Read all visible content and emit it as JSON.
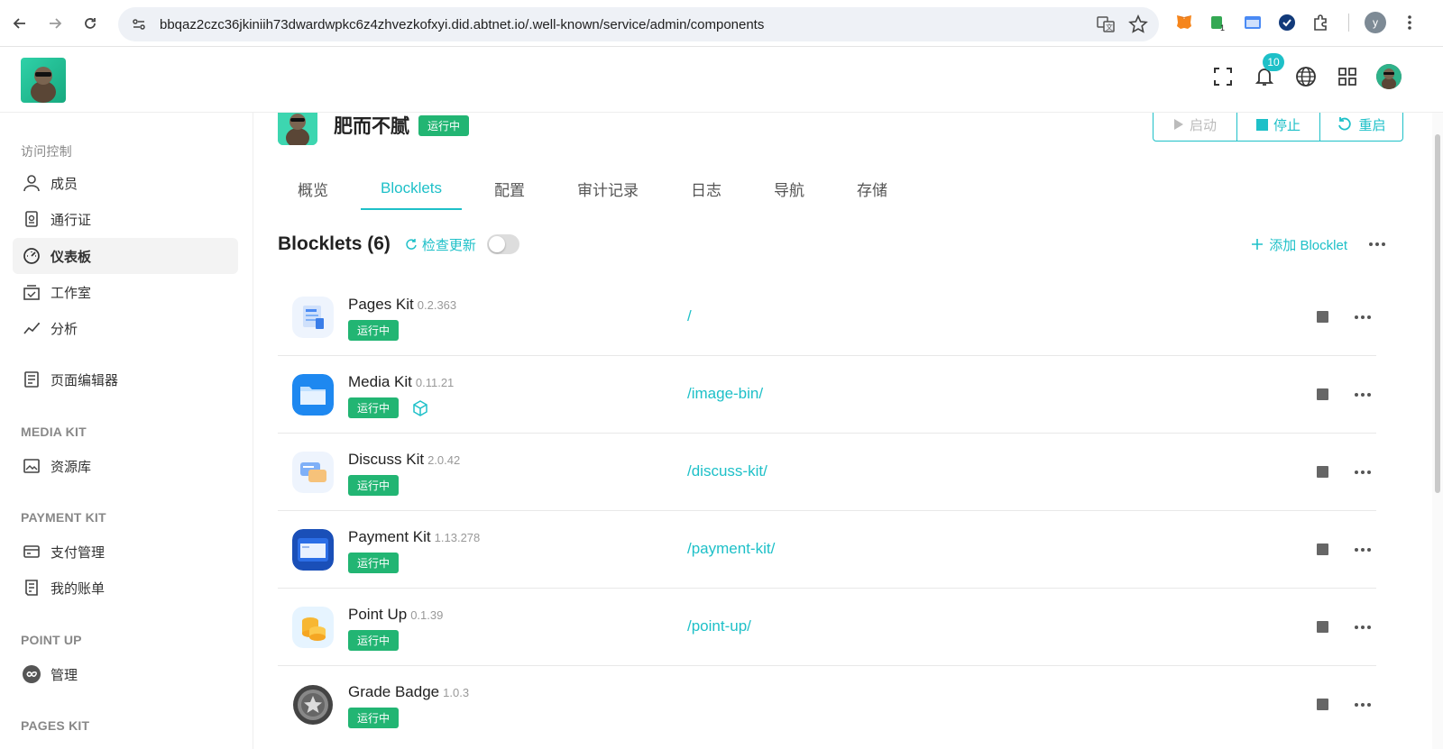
{
  "browser": {
    "url": "bbqaz2czc36jkiniih73dwardwpkc6z4zhvezkofxyi.did.abtnet.io/.well-known/service/admin/components",
    "profile_initial": "y"
  },
  "header": {
    "notification_count": "10"
  },
  "sidebar": {
    "section_access": "访问控制",
    "items_access": [
      {
        "label": "成员",
        "icon": "user-icon"
      },
      {
        "label": "通行证",
        "icon": "passport-icon"
      },
      {
        "label": "仪表板",
        "icon": "dashboard-icon"
      },
      {
        "label": "工作室",
        "icon": "studio-icon"
      },
      {
        "label": "分析",
        "icon": "analytics-icon"
      },
      {
        "label": "页面编辑器",
        "icon": "page-editor-icon"
      }
    ],
    "section_media": "MEDIA KIT",
    "media_item": "资源库",
    "section_payment": "PAYMENT KIT",
    "payment_items": [
      "支付管理",
      "我的账单"
    ],
    "section_point": "POINT UP",
    "point_item": "管理",
    "section_pages": "PAGES KIT"
  },
  "app": {
    "name": "肥而不腻",
    "status": "运行中",
    "actions": {
      "start": "启动",
      "stop": "停止",
      "restart": "重启"
    }
  },
  "tabs": [
    "概览",
    "Blocklets",
    "配置",
    "审计记录",
    "日志",
    "导航",
    "存储"
  ],
  "active_tab": "Blocklets",
  "list": {
    "title": "Blocklets (6)",
    "check_update": "检查更新",
    "add_label": "添加 Blocklet",
    "rows": [
      {
        "name": "Pages Kit",
        "version": "0.2.363",
        "status": "运行中",
        "mount": "/",
        "icon": "pages-kit-icon"
      },
      {
        "name": "Media Kit",
        "version": "0.11.21",
        "status": "运行中",
        "mount": "/image-bin/",
        "icon": "media-kit-icon"
      },
      {
        "name": "Discuss Kit",
        "version": "2.0.42",
        "status": "运行中",
        "mount": "/discuss-kit/",
        "icon": "discuss-kit-icon"
      },
      {
        "name": "Payment Kit",
        "version": "1.13.278",
        "status": "运行中",
        "mount": "/payment-kit/",
        "icon": "payment-kit-icon"
      },
      {
        "name": "Point Up",
        "version": "0.1.39",
        "status": "运行中",
        "mount": "/point-up/",
        "icon": "point-up-icon"
      },
      {
        "name": "Grade Badge",
        "version": "1.0.3",
        "status": "运行中",
        "mount": "",
        "icon": "grade-badge-icon"
      }
    ]
  },
  "colors": {
    "accent": "#1ec0c8",
    "status_green": "#22b573"
  }
}
